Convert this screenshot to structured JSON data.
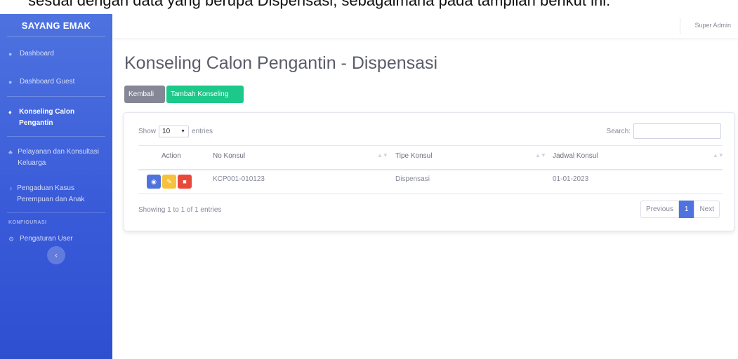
{
  "top_cut_text": "sesuai dengan data yang berupa Dispensasi, sebagaimana pada tampilan berikut ini:",
  "sidebar": {
    "brand": "SAYANG EMAK",
    "items": [
      {
        "label": "Dashboard",
        "icon": "tachometer-icon"
      },
      {
        "label": "Dashboard Guest",
        "icon": "tachometer-icon"
      },
      {
        "label": "Konseling Calon Pengantin",
        "icon": "restroom-icon",
        "active": true
      },
      {
        "label": "Pelayanan dan Konsultasi Keluarga",
        "icon": "users-icon"
      },
      {
        "label": "Pengaduan Kasus Perempuan dan Anak",
        "icon": "female-icon"
      }
    ],
    "section_heading": "KONFIGURASI",
    "config_items": [
      {
        "label": "Pengaturan User",
        "icon": "gears-icon"
      }
    ],
    "toggle_icon": "‹"
  },
  "topbar": {
    "user_name": "Super Admin"
  },
  "page": {
    "title": "Konseling Calon Pengantin - Dispensasi",
    "buttons": {
      "back": "Kembali",
      "add": "Tambah Konseling"
    }
  },
  "table": {
    "show_label": "Show",
    "entries_label": "entries",
    "page_length": "10",
    "search_label": "Search:",
    "columns": [
      "Action",
      "No Konsul",
      "Tipe Konsul",
      "Jadwal Konsul"
    ],
    "rows": [
      {
        "no_konsul": "KCP001-010123",
        "tipe_konsul": "Dispensasi",
        "jadwal_konsul": "01-01-2023"
      }
    ],
    "info": "Showing 1 to 1 of 1 entries",
    "pagination": {
      "previous": "Previous",
      "current": "1",
      "next": "Next"
    }
  },
  "colors": {
    "primary": "#4e73df",
    "success": "#1cc88a",
    "warning": "#f6c23e",
    "danger": "#e74a3b",
    "secondary": "#858796"
  }
}
